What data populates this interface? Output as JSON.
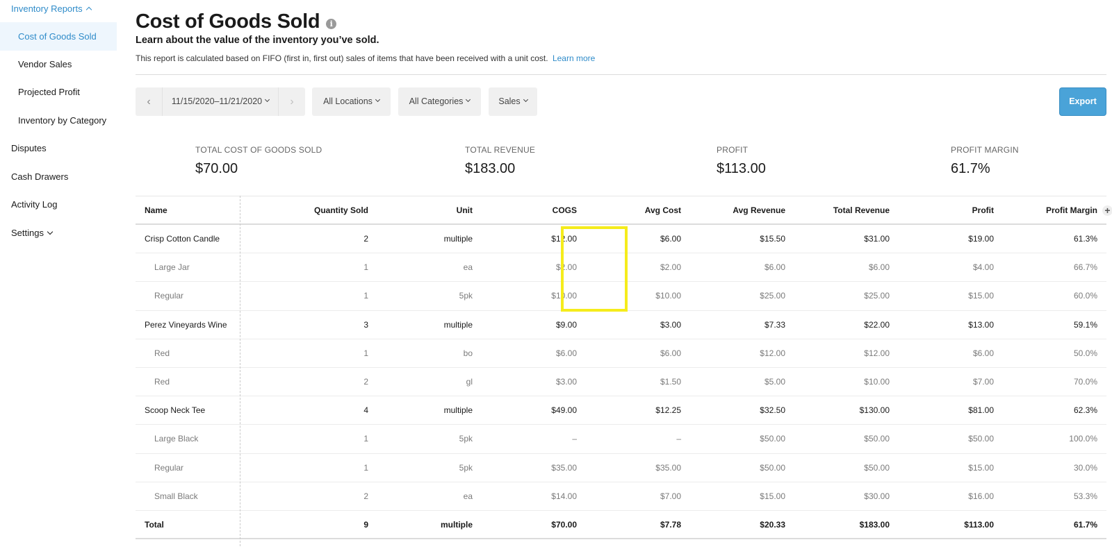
{
  "sidebar": {
    "section_label": "Inventory Reports",
    "items": [
      {
        "label": "Cost of Goods Sold"
      },
      {
        "label": "Vendor Sales"
      },
      {
        "label": "Projected Profit"
      },
      {
        "label": "Inventory by Category"
      }
    ],
    "top_items": [
      {
        "label": "Disputes"
      },
      {
        "label": "Cash Drawers"
      },
      {
        "label": "Activity Log"
      },
      {
        "label": "Settings"
      }
    ]
  },
  "header": {
    "title": "Cost of Goods Sold",
    "info_glyph": "i",
    "subtitle": "Learn about the value of the inventory you’ve sold.",
    "description": "This report is calculated based on FIFO (first in, first out) sales of items that have been received with a unit cost.",
    "learn_more": "Learn more"
  },
  "filters": {
    "prev": "‹",
    "date_range": "11/15/2020–11/21/2020",
    "next": "›",
    "locations": "All Locations",
    "categories": "All Categories",
    "sales": "Sales",
    "export": "Export"
  },
  "summary": {
    "cogs_label": "TOTAL COST OF GOODS SOLD",
    "cogs_value": "$70.00",
    "revenue_label": "TOTAL REVENUE",
    "revenue_value": "$183.00",
    "profit_label": "PROFIT",
    "profit_value": "$113.00",
    "margin_label": "PROFIT MARGIN",
    "margin_value": "61.7%"
  },
  "table": {
    "columns": [
      "Name",
      "Quantity Sold",
      "Unit",
      "COGS",
      "Avg Cost",
      "Avg Revenue",
      "Total Revenue",
      "Profit",
      "Profit Margin"
    ],
    "add_column_icon": "+",
    "rows": [
      {
        "type": "parent",
        "cells": [
          "Crisp Cotton Candle",
          "2",
          "multiple",
          "$12.00",
          "$6.00",
          "$15.50",
          "$31.00",
          "$19.00",
          "61.3%"
        ]
      },
      {
        "type": "child",
        "cells": [
          "Large Jar",
          "1",
          "ea",
          "$2.00",
          "$2.00",
          "$6.00",
          "$6.00",
          "$4.00",
          "66.7%"
        ]
      },
      {
        "type": "child",
        "cells": [
          "Regular",
          "1",
          "5pk",
          "$10.00",
          "$10.00",
          "$25.00",
          "$25.00",
          "$15.00",
          "60.0%"
        ]
      },
      {
        "type": "parent",
        "cells": [
          "Perez Vineyards Wine",
          "3",
          "multiple",
          "$9.00",
          "$3.00",
          "$7.33",
          "$22.00",
          "$13.00",
          "59.1%"
        ]
      },
      {
        "type": "child",
        "cells": [
          "Red",
          "1",
          "bo",
          "$6.00",
          "$6.00",
          "$12.00",
          "$12.00",
          "$6.00",
          "50.0%"
        ]
      },
      {
        "type": "child",
        "cells": [
          "Red",
          "2",
          "gl",
          "$3.00",
          "$1.50",
          "$5.00",
          "$10.00",
          "$7.00",
          "70.0%"
        ]
      },
      {
        "type": "parent",
        "cells": [
          "Scoop Neck Tee",
          "4",
          "multiple",
          "$49.00",
          "$12.25",
          "$32.50",
          "$130.00",
          "$81.00",
          "62.3%"
        ]
      },
      {
        "type": "child",
        "cells": [
          "Large Black",
          "1",
          "5pk",
          "–",
          "–",
          "$50.00",
          "$50.00",
          "$50.00",
          "100.0%"
        ]
      },
      {
        "type": "child",
        "cells": [
          "Regular",
          "1",
          "5pk",
          "$35.00",
          "$35.00",
          "$50.00",
          "$50.00",
          "$15.00",
          "30.0%"
        ]
      },
      {
        "type": "child",
        "cells": [
          "Small Black",
          "2",
          "ea",
          "$14.00",
          "$7.00",
          "$15.00",
          "$30.00",
          "$16.00",
          "53.3%"
        ]
      },
      {
        "type": "total",
        "cells": [
          "Total",
          "9",
          "multiple",
          "$70.00",
          "$7.78",
          "$20.33",
          "$183.00",
          "$113.00",
          "61.7%"
        ]
      }
    ]
  }
}
